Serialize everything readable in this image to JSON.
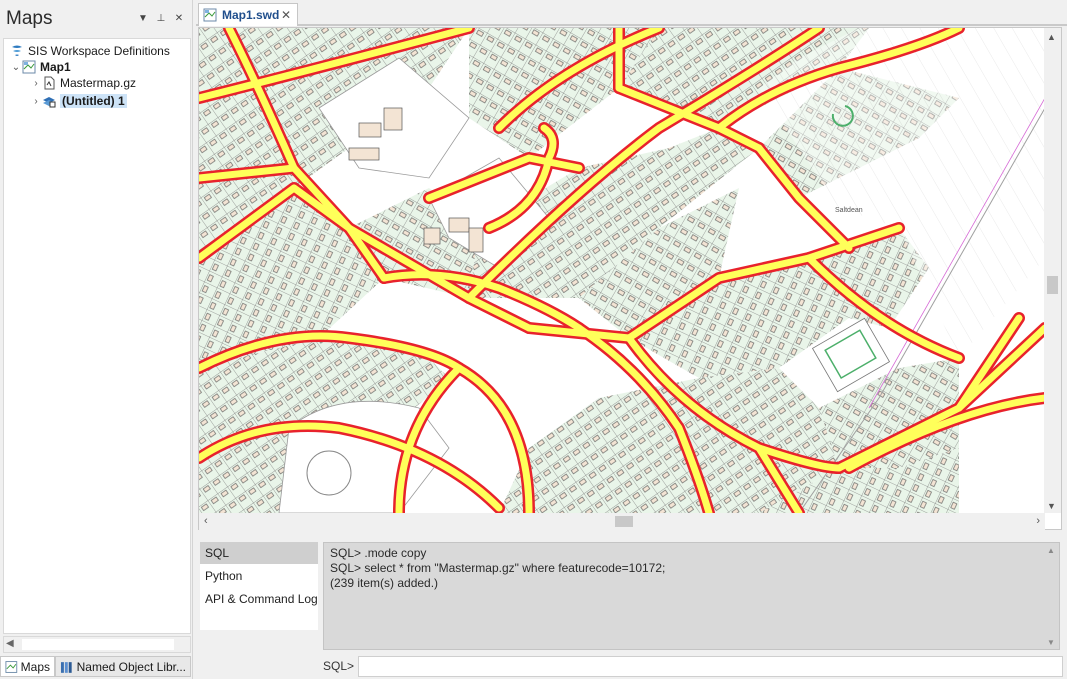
{
  "left_panel": {
    "title": "Maps",
    "buttons": {
      "dropdown": "▼",
      "pin": "⊥",
      "close": "✕"
    },
    "tree": {
      "root": "SIS Workspace Definitions",
      "map": "Map1",
      "items": [
        "Mastermap.gz",
        "(Untitled) 1"
      ]
    }
  },
  "bottom_tabs": [
    "Maps",
    "Named Object Libr..."
  ],
  "document_tab": {
    "label": "Map1.swd",
    "close": "✕"
  },
  "map": {
    "place_label": "Saltdean"
  },
  "console": {
    "tabs": [
      "SQL",
      "Python",
      "API & Command Log"
    ],
    "active_tab": "SQL",
    "output": [
      "SQL> .mode copy",
      "SQL> select * from \"Mastermap.gz\" where featurecode=10172;",
      "(239 item(s) added.)"
    ],
    "prompt": "SQL>",
    "input_value": ""
  },
  "colors": {
    "road_fill": "#ffff5a",
    "road_casing": "#e8222c",
    "building": "#f3e4d4",
    "garden": "#e9f5e9",
    "selection": "#cde3f7"
  }
}
